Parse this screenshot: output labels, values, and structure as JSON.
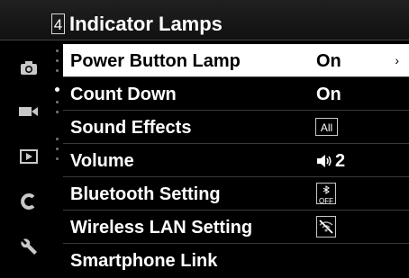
{
  "header": {
    "page_number": "4",
    "title": "Indicator Lamps"
  },
  "sidebar": {
    "icons": [
      "camera-icon",
      "video-camera-icon",
      "playback-icon",
      "custom-c-icon",
      "wrench-icon"
    ]
  },
  "menu": {
    "items": [
      {
        "label": "Power Button Lamp",
        "value": "On",
        "selected": true
      },
      {
        "label": "Count Down",
        "value": "On"
      },
      {
        "label": "Sound Effects",
        "value": "All"
      },
      {
        "label": "Volume",
        "value": "2"
      },
      {
        "label": "Bluetooth Setting",
        "value": "OFF"
      },
      {
        "label": "Wireless LAN Setting",
        "value": ""
      },
      {
        "label": "Smartphone Link",
        "value": ""
      }
    ],
    "chevron": "›"
  },
  "colors": {
    "selected_bg": "#ffffff",
    "background": "#000000",
    "divider": "#3a3a3a"
  }
}
